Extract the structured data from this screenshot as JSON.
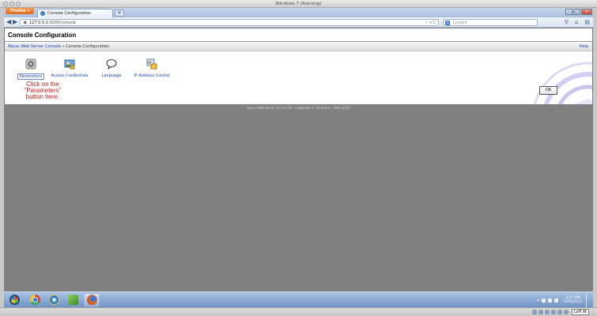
{
  "vm_window": {
    "title": "Windows 7 (Running)"
  },
  "browser": {
    "firefox_button_label": "Firefox ▾",
    "tab_title": "Console Configuration",
    "new_tab_label": "+",
    "url_host": "127.0.0.1",
    "url_rest": ":9000/console",
    "url_right": "☆ ▾ C",
    "search_engine_letter": "G",
    "search_placeholder": "Google",
    "nav_back": "◀",
    "nav_forward": "▶"
  },
  "page": {
    "title": "Console Configuration",
    "breadcrumb_link": "Abyss Web Server Console",
    "breadcrumb_separator": "»",
    "breadcrumb_current": "Console Configuration",
    "help_label": "Help",
    "tools": [
      {
        "label": "Parameters",
        "icon": "parameters-icon"
      },
      {
        "label": "Access Credentials",
        "icon": "credentials-icon"
      },
      {
        "label": "Language",
        "icon": "speech-bubble-icon"
      },
      {
        "label": "IP Address Control",
        "icon": "ip-control-icon"
      }
    ],
    "instruction_line1": "Click on the",
    "instruction_line2": "\"Parameters\"",
    "instruction_line3": "button here.",
    "ok_label": "OK",
    "footer": "Abyss Web Server X1 (v 2.8) - Copyright © Aprelium - 2001-2012"
  },
  "taskbar": {
    "clock_time": "3:47 PM",
    "clock_date": "2/28/2012"
  },
  "host_bar": {
    "left_key_label": "Left ⌘"
  },
  "colors": {
    "link": "#1a3fbf",
    "instruction": "#d01a1a",
    "page_bg": "#808080"
  }
}
